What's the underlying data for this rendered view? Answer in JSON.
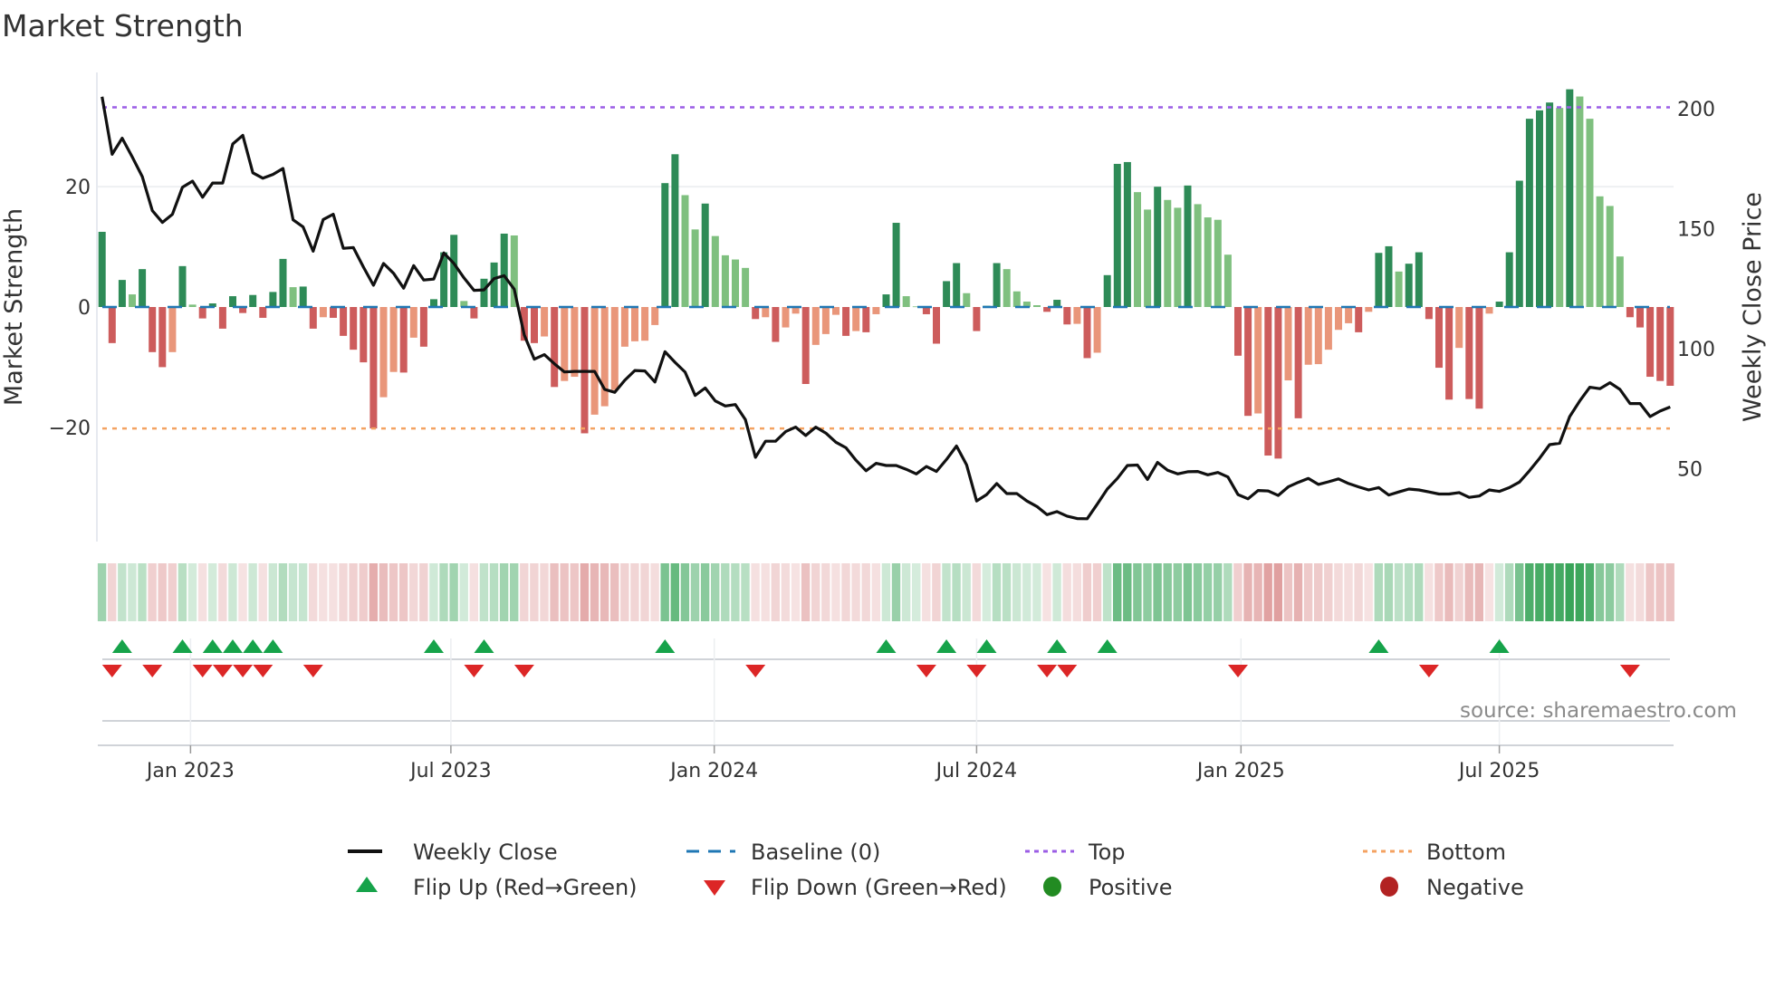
{
  "chart_data": {
    "type": "bar",
    "title": "Market Strength",
    "ylabel": "Market Strength",
    "y2label": "Weekly Close Price",
    "ylim": [
      -39,
      39
    ],
    "y2lim": [
      19.6,
      215.1
    ],
    "yticks": [
      {
        "value": 20,
        "label": "20"
      },
      {
        "value": 0,
        "label": "0"
      },
      {
        "value": -20,
        "label": "−20"
      }
    ],
    "y2ticks": [
      {
        "value": 200,
        "label": "200"
      },
      {
        "value": 150,
        "label": "150"
      },
      {
        "value": 100,
        "label": "100"
      },
      {
        "value": 50,
        "label": "50"
      }
    ],
    "xticks": [
      {
        "week": 8.8,
        "label": "Jan 2023"
      },
      {
        "week": 34.7,
        "label": "Jul 2023"
      },
      {
        "week": 60.9,
        "label": "Jan 2024"
      },
      {
        "week": 87.0,
        "label": "Jul 2024"
      },
      {
        "week": 113.3,
        "label": "Jan 2025"
      },
      {
        "week": 139.0,
        "label": "Jul 2025"
      }
    ],
    "top_level": 33.2,
    "bottom_level": -20.2,
    "baseline": 0,
    "strength": [
      12.5,
      -6.0,
      4.5,
      2.1,
      6.3,
      -7.5,
      -10.0,
      -7.5,
      6.8,
      0.4,
      -1.9,
      0.6,
      -3.6,
      1.8,
      -1.0,
      2.0,
      -1.8,
      2.5,
      8.0,
      3.3,
      3.4,
      -3.6,
      -1.7,
      -1.8,
      -4.8,
      -7.1,
      -9.2,
      -20.2,
      -15.0,
      -10.8,
      -10.9,
      -5.1,
      -6.6,
      1.3,
      9.1,
      12.0,
      1.0,
      -1.9,
      4.7,
      7.4,
      12.2,
      11.9,
      -5.6,
      -6.0,
      -4.9,
      -13.3,
      -12.3,
      -11.6,
      -21.0,
      -17.9,
      -16.5,
      -13.8,
      -6.6,
      -5.7,
      -5.6,
      -3.0,
      20.6,
      25.4,
      18.6,
      12.9,
      17.2,
      11.8,
      8.6,
      7.9,
      6.5,
      -2.0,
      -1.7,
      -5.8,
      -3.4,
      -1.1,
      -12.8,
      -6.3,
      -4.5,
      -1.3,
      -4.8,
      -4.0,
      -4.2,
      -1.2,
      2.1,
      14.0,
      1.8,
      0.1,
      -1.2,
      -6.1,
      4.3,
      7.3,
      2.3,
      -4.0,
      0.2,
      7.3,
      6.3,
      2.6,
      0.9,
      0.3,
      -0.8,
      1.2,
      -2.9,
      -2.8,
      -8.5,
      -7.6,
      5.3,
      23.8,
      24.1,
      19.1,
      16.2,
      20.0,
      17.8,
      16.5,
      20.2,
      17.1,
      14.9,
      14.5,
      8.7,
      -8.1,
      -18.1,
      -17.7,
      -24.7,
      -25.2,
      -12.2,
      -18.5,
      -9.6,
      -9.5,
      -7.1,
      -3.8,
      -2.7,
      -4.2,
      -0.8,
      9.0,
      10.1,
      5.9,
      7.2,
      9.1,
      -2.0,
      -10.1,
      -15.4,
      -6.8,
      -15.3,
      -16.9,
      -1.1,
      0.9,
      9.1,
      21.0,
      31.3,
      32.7,
      34.0,
      33.1,
      36.2,
      35.0,
      31.3,
      18.4,
      16.8,
      8.4,
      -1.7,
      -3.4,
      -11.6,
      -12.3,
      -13.1
    ],
    "weekly_close": [
      205,
      181,
      187.7,
      179.9,
      171.7,
      157.5,
      152.6,
      156,
      167.3,
      169.8,
      163.1,
      169,
      169,
      185.3,
      188.9,
      173.3,
      171,
      172.6,
      175.1,
      153.7,
      150.7,
      140.6,
      153.8,
      156,
      141.8,
      142.1,
      134,
      126.4,
      135.5,
      131.4,
      125.2,
      134.6,
      128.6,
      129,
      139.9,
      135.5,
      129.5,
      124.3,
      124.5,
      129.2,
      130.4,
      124.8,
      105.7,
      95.6,
      97.5,
      93.7,
      90.3,
      90.5,
      90.5,
      90.5,
      83,
      81.8,
      86.8,
      90.9,
      90.7,
      86.1,
      98.7,
      94.3,
      90.2,
      80.5,
      83.6,
      78.2,
      76.1,
      76.7,
      70.4,
      54.7,
      61.4,
      61.4,
      65.4,
      67.3,
      63.8,
      67.3,
      64.8,
      61.0,
      58.7,
      53.5,
      49.1,
      52.2,
      51.3,
      51.3,
      49.7,
      47.8,
      50.9,
      48.8,
      53.8,
      59.4,
      51.6,
      36.5,
      39.2,
      43.8,
      39.6,
      39.6,
      36.5,
      34.2,
      30.8,
      32.1,
      30.2,
      29.2,
      29.1,
      35.2,
      41.5,
      45.9,
      51.3,
      51.5,
      45.5,
      52.6,
      49.3,
      47.8,
      48.7,
      48.8,
      47.4,
      48.4,
      46.5,
      39.2,
      37.4,
      40.9,
      40.7,
      38.8,
      42.4,
      44.3,
      45.9,
      43.4,
      44.5,
      45.7,
      43.8,
      42.4,
      41.1,
      42.1,
      39.0,
      40.3,
      41.5,
      41.1,
      40.3,
      39.4,
      39.4,
      40.0,
      38.0,
      38.6,
      41.1,
      40.5,
      42.1,
      44.4,
      49.1,
      54.3,
      60.0,
      60.6,
      71.7,
      78.2,
      83.9,
      83.3,
      85.8,
      83.0,
      77.1,
      77.1,
      71.7,
      74.0,
      75.7
    ],
    "colors": {
      "pos_rising": "#2e8b57",
      "pos_falling": "#7fc07f",
      "neg_falling": "#cd5c5c",
      "neg_rising": "#e9967a",
      "line": "#111111",
      "baseline": "#1f77b4",
      "top": "#9b5de5",
      "bottom": "#f4a261",
      "flip_up": "#16a34a",
      "flip_down": "#dc2626",
      "positive": "#228b22",
      "negative": "#b22222"
    },
    "legend": {
      "placement": "bottom-center",
      "items": [
        {
          "key": "weekly_close",
          "label": "Weekly Close"
        },
        {
          "key": "baseline",
          "label": "Baseline (0)"
        },
        {
          "key": "top",
          "label": "Top"
        },
        {
          "key": "bottom",
          "label": "Bottom"
        },
        {
          "key": "flip_up",
          "label": "Flip Up (Red→Green)"
        },
        {
          "key": "flip_down",
          "label": "Flip Down (Green→Red)"
        },
        {
          "key": "positive",
          "label": "Positive"
        },
        {
          "key": "negative",
          "label": "Negative"
        }
      ]
    },
    "source": "source: sharemaestro.com"
  }
}
